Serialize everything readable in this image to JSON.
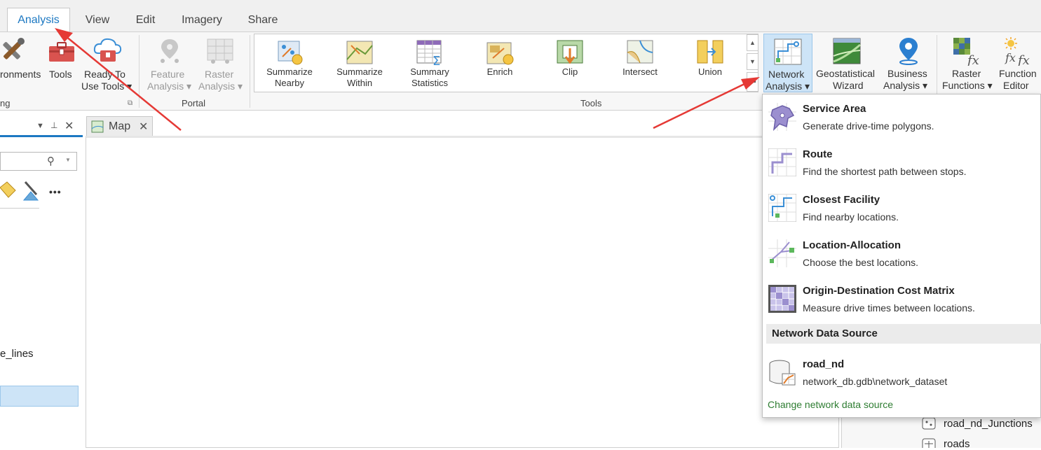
{
  "tabs": [
    {
      "label": "Analysis",
      "active": true
    },
    {
      "label": "View"
    },
    {
      "label": "Edit"
    },
    {
      "label": "Imagery"
    },
    {
      "label": "Share"
    }
  ],
  "ribbon": {
    "environments_label": "ronments",
    "tools_label": "Tools",
    "ready_line1": "Ready To",
    "ready_line2": "Use Tools",
    "feature_line1": "Feature",
    "feature_line2": "Analysis",
    "raster_line1": "Raster",
    "raster_line2": "Analysis",
    "group_ng": "ng",
    "group_portal": "Portal",
    "group_tools": "Tools",
    "gallery": [
      {
        "line1": "Summarize",
        "line2": "Nearby"
      },
      {
        "line1": "Summarize",
        "line2": "Within"
      },
      {
        "line1": "Summary",
        "line2": "Statistics"
      },
      {
        "line1": "Enrich",
        "line2": ""
      },
      {
        "line1": "Clip",
        "line2": ""
      },
      {
        "line1": "Intersect",
        "line2": ""
      },
      {
        "line1": "Union",
        "line2": ""
      }
    ],
    "network_line1": "Network",
    "network_line2": "Analysis",
    "geostat_line1": "Geostatistical",
    "geostat_line2": "Wizard",
    "business_line1": "Business",
    "business_line2": "Analysis",
    "rasterfx_line1": "Raster",
    "rasterfx_line2": "Functions",
    "fxeditor_line1": "Function",
    "fxeditor_line2": "Editor"
  },
  "map_tab": {
    "label": "Map"
  },
  "left_pane": {
    "tree_label": "e_lines",
    "more": "•••"
  },
  "right_pane": {
    "junctions": "road_nd_Junctions",
    "roads": "roads"
  },
  "dropdown": {
    "items": [
      {
        "title": "Service Area",
        "desc": "Generate drive-time polygons.",
        "icon": "service-area-icon"
      },
      {
        "title": "Route",
        "desc": "Find the shortest path between stops.",
        "icon": "route-icon"
      },
      {
        "title": "Closest Facility",
        "desc": "Find nearby locations.",
        "icon": "closest-facility-icon"
      },
      {
        "title": "Location-Allocation",
        "desc": "Choose the best locations.",
        "icon": "location-allocation-icon"
      },
      {
        "title": "Origin-Destination Cost Matrix",
        "desc": "Measure drive times between locations.",
        "icon": "od-cost-matrix-icon"
      }
    ],
    "section_title": "Network Data Source",
    "source_title": "road_nd",
    "source_path": "network_db.gdb\\network_dataset",
    "change_link": "Change network data source"
  },
  "colors": {
    "accent": "#1c78c2",
    "selected_bg": "#cde4f7",
    "link": "#2e7d32",
    "arrow": "#e53935"
  }
}
